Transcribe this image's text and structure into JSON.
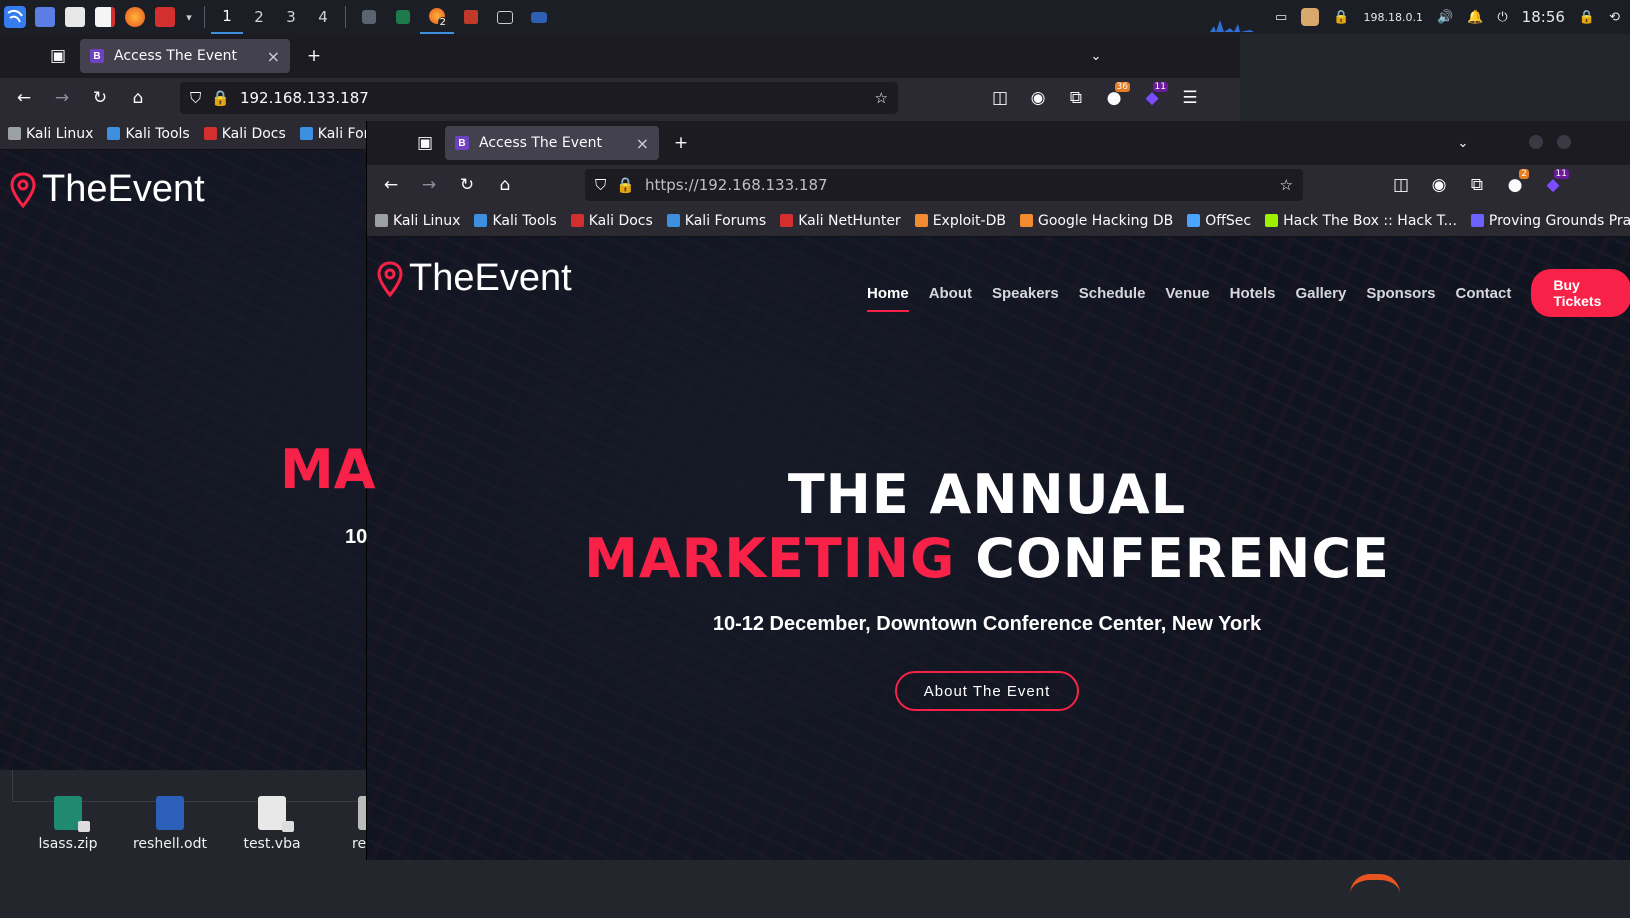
{
  "taskbar": {
    "workspaces": [
      "1",
      "2",
      "3",
      "4"
    ],
    "active_workspace": "1",
    "firefox_badge": "2",
    "ip": "198.18.0.1",
    "time": "18:56"
  },
  "back_browser": {
    "tab_title": "Access The Event",
    "url": "192.168.133.187",
    "ext_badge_1": "36",
    "ext_badge_2": "11",
    "bookmarks": [
      "Kali Linux",
      "Kali Tools",
      "Kali Docs",
      "Kali Forum"
    ],
    "logo": "TheEvent",
    "headline_fragment": "MA",
    "subline_fragment": "10"
  },
  "front_browser": {
    "tab_title": "Access The Event",
    "url": "https://192.168.133.187",
    "ext_badge_1": "2",
    "ext_badge_2": "11",
    "bookmarks": [
      {
        "label": "Kali Linux",
        "color": "#9aa0a6"
      },
      {
        "label": "Kali Tools",
        "color": "#3d8fe0"
      },
      {
        "label": "Kali Docs",
        "color": "#d32f2f"
      },
      {
        "label": "Kali Forums",
        "color": "#3d8fe0"
      },
      {
        "label": "Kali NetHunter",
        "color": "#d32f2f"
      },
      {
        "label": "Exploit-DB",
        "color": "#f28b30"
      },
      {
        "label": "Google Hacking DB",
        "color": "#f28b30"
      },
      {
        "label": "OffSec",
        "color": "#4aa3ff"
      },
      {
        "label": "Hack The Box :: Hack T...",
        "color": "#9fef00"
      },
      {
        "label": "Proving Grounds Pract...",
        "color": "#6c63ff"
      }
    ]
  },
  "site": {
    "logo": "TheEvent",
    "nav": [
      "Home",
      "About",
      "Speakers",
      "Schedule",
      "Venue",
      "Hotels",
      "Gallery",
      "Sponsors",
      "Contact"
    ],
    "active_nav": "Home",
    "buy_button": "Buy Tickets",
    "headline_line1": "THE ANNUAL",
    "headline_accent": "MARKETING",
    "headline_rest": "CONFERENCE",
    "subheadline": "10-12 December, Downtown Conference Center, New York",
    "cta": "About The Event",
    "accent_color": "#f82249"
  },
  "desktop": {
    "icons": [
      "lsass.zip",
      "reshell.odt",
      "test.vba",
      "re"
    ]
  }
}
